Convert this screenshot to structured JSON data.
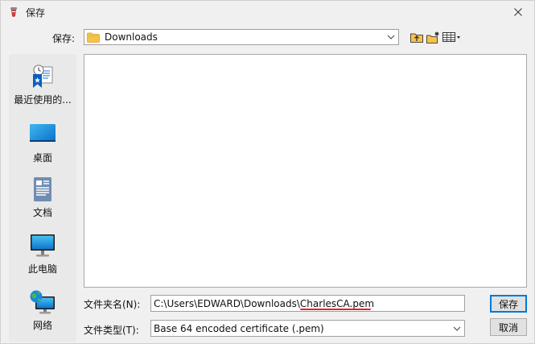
{
  "window": {
    "title": "保存"
  },
  "save_in": {
    "label": "保存:",
    "location": "Downloads"
  },
  "places": [
    {
      "label": "最近使用的...",
      "icon": "recent-places-icon"
    },
    {
      "label": "桌面",
      "icon": "desktop-icon"
    },
    {
      "label": "文档",
      "icon": "documents-icon"
    },
    {
      "label": "此电脑",
      "icon": "this-pc-icon"
    },
    {
      "label": "网络",
      "icon": "network-icon"
    }
  ],
  "file_name": {
    "label": "文件夹名(N):",
    "value": "C:\\Users\\EDWARD\\Downloads\\CharlesCA.pem"
  },
  "file_type": {
    "label": "文件类型(T):",
    "value": "Base 64 encoded certificate (.pem)"
  },
  "buttons": {
    "save": "保存",
    "cancel": "取消"
  },
  "colors": {
    "accent": "#0078d7",
    "annotation_underline": "#d9272e",
    "folder": "#f5c24b"
  }
}
